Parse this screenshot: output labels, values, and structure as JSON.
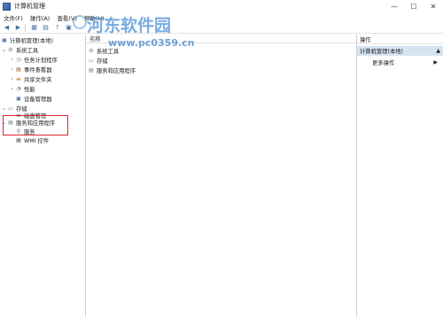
{
  "window": {
    "title": "计算机管理",
    "minimize": "—",
    "maximize": "☐",
    "close": "✕"
  },
  "menubar": [
    "文件(F)",
    "操作(A)",
    "查看(V)",
    "帮助(H)"
  ],
  "watermark": {
    "title": "河东软件园",
    "url": "www.pc0359.cn"
  },
  "tree": {
    "root": "计算机管理(本地)",
    "system_tools": "系统工具",
    "task_scheduler": "任务计划程序",
    "event_viewer": "事件查看器",
    "shared_folders": "共享文件夹",
    "performance": "性能",
    "device_manager": "设备管理器",
    "storage": "存储",
    "disk_management": "磁盘管理",
    "services_apps": "服务和应用程序",
    "services": "服务",
    "wmi": "WMI 控件"
  },
  "middle": {
    "column_name": "名称",
    "rows": [
      "系统工具",
      "存储",
      "服务和应用程序"
    ]
  },
  "actions": {
    "title": "操作",
    "group": "计算机管理(本地)",
    "more": "更多操作"
  },
  "colors": {
    "highlight": "#d9272e",
    "action_group_bg": "#d6e4f2"
  }
}
